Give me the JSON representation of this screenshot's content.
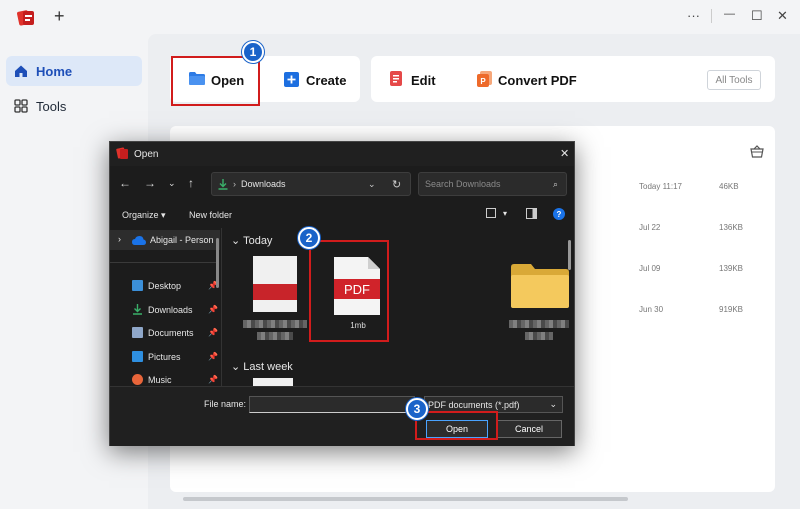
{
  "titlebar": {
    "new_tab": "+",
    "more": "···",
    "minimize": "—",
    "maximize": "☐",
    "close": "✕"
  },
  "sidebar": {
    "items": [
      {
        "label": "Home"
      },
      {
        "label": "Tools"
      }
    ]
  },
  "tiles": {
    "open": "Open",
    "create": "Create",
    "edit": "Edit",
    "convert": "Convert PDF",
    "all_tools": "All Tools"
  },
  "recent": [
    {
      "date": "Today 11:17",
      "size": "46KB"
    },
    {
      "date": "Jul 22",
      "size": "136KB"
    },
    {
      "date": "Jul 09",
      "size": "139KB"
    },
    {
      "date": "Jun 30",
      "size": "919KB"
    }
  ],
  "badges": [
    "1",
    "2",
    "3"
  ],
  "dialog": {
    "title": "Open",
    "address": "Downloads",
    "search_placeholder": "Search Downloads",
    "organize": "Organize",
    "new_folder": "New folder",
    "nav": {
      "user": "Abigail - Person",
      "items": [
        {
          "label": "Desktop"
        },
        {
          "label": "Downloads"
        },
        {
          "label": "Documents"
        },
        {
          "label": "Pictures"
        },
        {
          "label": "Music"
        }
      ]
    },
    "sections": {
      "today": "Today",
      "last_week": "Last week"
    },
    "files": {
      "pdf_icon_text": "PDF",
      "pdf_name": "1mb"
    },
    "file_name_label": "File name:",
    "file_name_value": "",
    "file_type": "PDF documents (*.pdf)",
    "open_button": "Open",
    "cancel_button": "Cancel"
  },
  "colors": {
    "accent": "#1a63c9",
    "highlight": "#d11c1c",
    "brand": "#e0322b"
  }
}
